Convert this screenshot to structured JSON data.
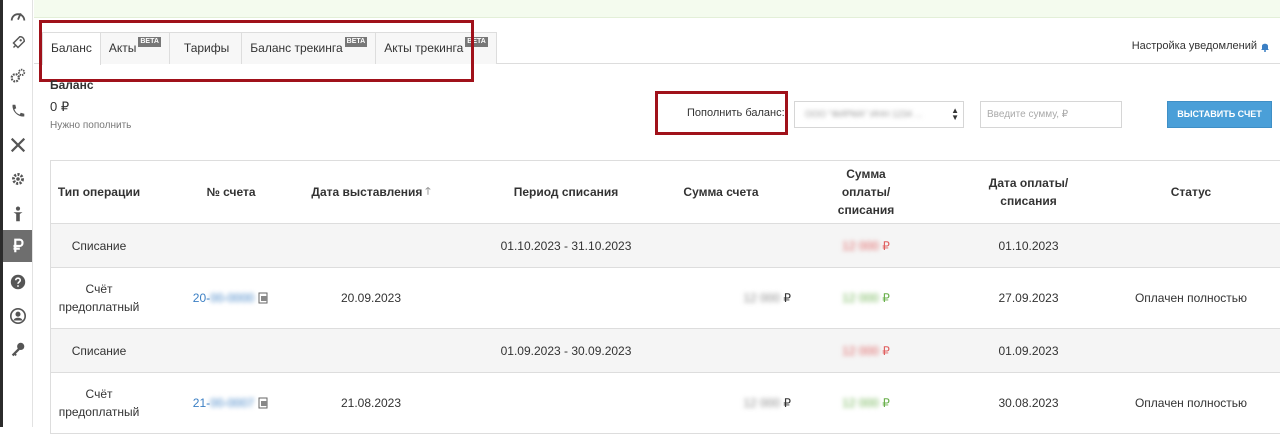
{
  "sidebar": {
    "items": [
      {
        "icon": "dashboard-gauge-icon"
      },
      {
        "icon": "rocket-icon"
      },
      {
        "icon": "gears-icon"
      },
      {
        "icon": "phone-icon"
      },
      {
        "icon": "tools-icon"
      },
      {
        "icon": "gear-icon"
      },
      {
        "icon": "person-icon"
      },
      {
        "icon": "ruble-icon",
        "active": true
      },
      {
        "icon": "help-icon"
      },
      {
        "icon": "user-circle-icon"
      },
      {
        "icon": "key-icon"
      }
    ]
  },
  "tabs": [
    {
      "label": "Баланс",
      "active": true
    },
    {
      "label": "Акты",
      "badge": "BETA"
    },
    {
      "label": "Тарифы"
    },
    {
      "label": "Баланс трекинга",
      "badge": "BETA"
    },
    {
      "label": "Акты трекинга",
      "badge": "BETA"
    }
  ],
  "notify_label": "Настройка уведомлений",
  "balance": {
    "title": "Баланс",
    "amount": "0 ₽",
    "hint": "Нужно пополнить"
  },
  "topup": {
    "label": "Пополнить баланс:",
    "account_value": "ООО \"ФИРМА\" ИНН 1234 ...",
    "amount_placeholder": "Введите сумму, ₽",
    "button_label": "ВЫСТАВИТЬ СЧЕТ"
  },
  "table": {
    "headers": {
      "type": "Тип операции",
      "number": "№ счета",
      "issue_date": "Дата выставления",
      "period": "Период списания",
      "invoice_sum": "Сумма счета",
      "paid_sum": "Сумма оплаты/списания",
      "paid_date": "Дата оплаты/списания",
      "status": "Статус"
    },
    "rows": [
      {
        "kind": "writeoff",
        "type": "Списание",
        "number_prefix": "",
        "number_hidden": "",
        "issue_date": "",
        "period": "01.10.2023 - 31.10.2023",
        "invoice_sum": "",
        "paid_sum_hidden": "12 000",
        "currency": "₽",
        "paid_date": "01.10.2023",
        "status": ""
      },
      {
        "kind": "prepaid",
        "type": "Счёт предоплатный",
        "number_prefix": "20-",
        "number_hidden": "00-0000",
        "issue_date": "20.09.2023",
        "period": "",
        "invoice_sum_hidden": "12 000",
        "invoice_currency": "₽",
        "paid_sum_hidden": "12 000",
        "currency": "₽",
        "paid_date": "27.09.2023",
        "status": "Оплачен полностью"
      },
      {
        "kind": "writeoff",
        "type": "Списание",
        "number_prefix": "",
        "number_hidden": "",
        "issue_date": "",
        "period": "01.09.2023 - 30.09.2023",
        "invoice_sum": "",
        "paid_sum_hidden": "12 000",
        "currency": "₽",
        "paid_date": "01.09.2023",
        "status": ""
      },
      {
        "kind": "prepaid",
        "type": "Счёт предоплатный",
        "number_prefix": "21-",
        "number_hidden": "00-0007",
        "issue_date": "21.08.2023",
        "period": "",
        "invoice_sum_hidden": "12 000",
        "invoice_currency": "₽",
        "paid_sum_hidden": "12 000",
        "currency": "₽",
        "paid_date": "30.08.2023",
        "status": "Оплачен полностью"
      }
    ]
  },
  "colors": {
    "accent_button": "#4a9fd8",
    "annotation_red": "#a0111a",
    "writeoff_amount": "#e06060",
    "paid_amount": "#6ab04c",
    "sidebar_active": "#6e6e6e"
  }
}
